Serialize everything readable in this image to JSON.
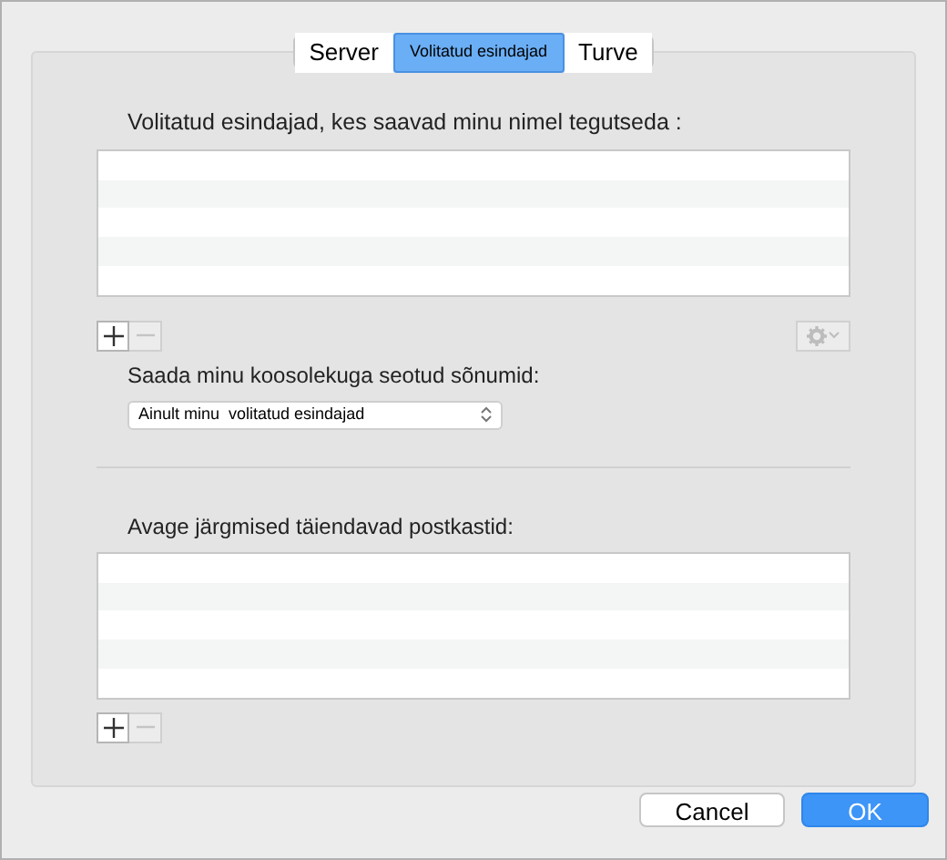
{
  "tabs": [
    {
      "label": "Server",
      "selected": false
    },
    {
      "label": "Volitatud esindajad",
      "selected": true
    },
    {
      "label": "Turve",
      "selected": false
    }
  ],
  "delegates": {
    "label": "Volitatud esindajad, kes saavad minu nimel tegutseda :",
    "add_disabled": false,
    "remove_disabled": true,
    "actions_disabled": true
  },
  "meeting_messages": {
    "label": "Saada minu koosolekuga seotud sõnumid:",
    "value": "Ainult minu  volitatud esindajad"
  },
  "mailboxes": {
    "label": "Avage järgmised täiendavad postkastid:",
    "add_disabled": false,
    "remove_disabled": true
  },
  "buttons": [
    {
      "label": "Cancel",
      "kind": "secondary"
    },
    {
      "label": "OK",
      "kind": "primary"
    }
  ]
}
